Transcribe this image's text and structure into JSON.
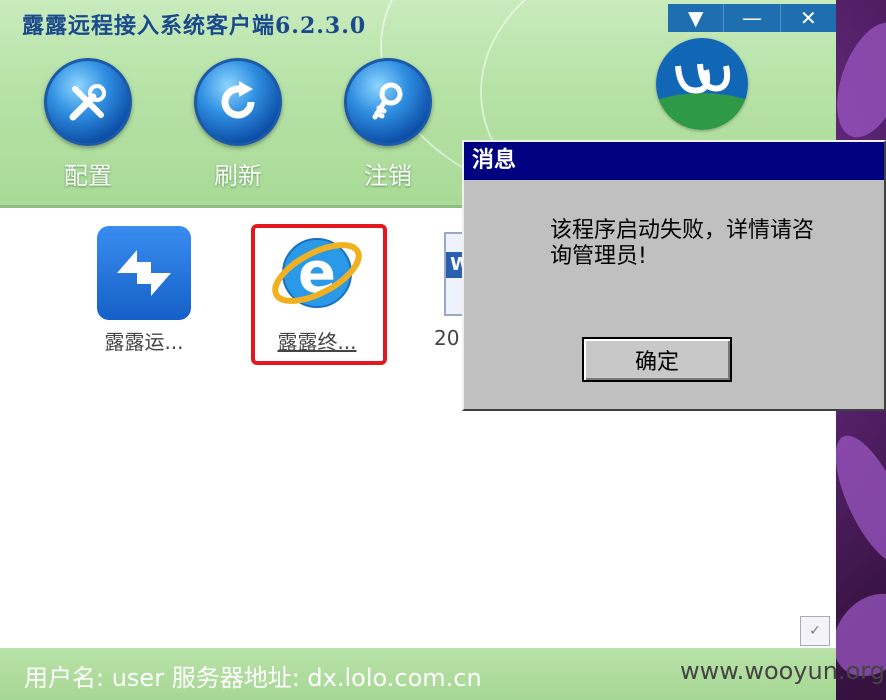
{
  "window": {
    "title": "露露远程接入系统客户端6.2.3.0",
    "controls": {
      "menu_icon": "chevron-down-icon",
      "minimize_icon": "minimize-icon",
      "close_icon": "close-icon",
      "close_glyph": "✕",
      "min_glyph": "—",
      "menu_glyph": "▼"
    },
    "accent": "#1f6fb0"
  },
  "toolbar": {
    "items": [
      {
        "label": "配置",
        "icon": "tools-icon"
      },
      {
        "label": "刷新",
        "icon": "refresh-icon"
      },
      {
        "label": "注销",
        "icon": "key-icon"
      }
    ]
  },
  "apps": [
    {
      "label": "露露运...",
      "icon": "remote-arrows-icon"
    },
    {
      "label": "露露终...",
      "icon": "ie-browser-icon",
      "selected": true
    },
    {
      "label": "20",
      "icon": "document-icon"
    }
  ],
  "status_bar": {
    "text": "用户名: user   服务器地址: dx.lolo.com.cn"
  },
  "watermark": "www.wooyun.org",
  "dialog": {
    "title": "消息",
    "message": "该程序启动失败，详情请咨询管理员!",
    "ok_label": "确定",
    "title_color": "#000080"
  }
}
